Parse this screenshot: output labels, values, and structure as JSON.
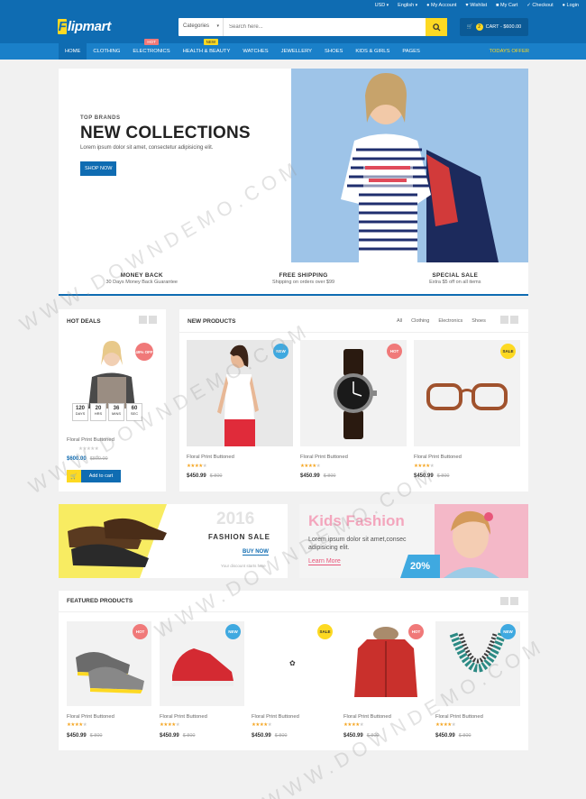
{
  "topbar": {
    "currency": "USD",
    "language": "English",
    "account": "My Account",
    "wishlist": "Wishlist",
    "cart": "My Cart",
    "checkout": "Checkout",
    "login": "Login"
  },
  "logo": "Flipmart",
  "search": {
    "category": "Categories",
    "placeholder": "Search here..."
  },
  "cart": {
    "count": "2",
    "label": "CART - $600.00"
  },
  "nav": {
    "items": [
      "HOME",
      "CLOTHING",
      "ELECTRONICS",
      "HEALTH & BEAUTY",
      "WATCHES",
      "JEWELLERY",
      "SHOES",
      "KIDS & GIRLS",
      "PAGES"
    ],
    "hot": "HOT",
    "new": "NEW",
    "today": "TODAYS OFFER"
  },
  "hero": {
    "top": "TOP BRANDS",
    "title": "NEW COLLECTIONS",
    "text": "Lorem ipsum dolor sit amet, consectetur adipisicing elit.",
    "btn": "SHOP NOW"
  },
  "features": [
    {
      "t": "MONEY BACK",
      "s": "30 Days Money Back Guarantee"
    },
    {
      "t": "FREE SHIPPING",
      "s": "Shipping on orders over $99"
    },
    {
      "t": "SPECIAL SALE",
      "s": "Extra $5 off on all items"
    }
  ],
  "hotdeals": {
    "title": "HOT DEALS",
    "badge": "49% OFF",
    "timer": [
      {
        "v": "120",
        "l": "DAYS"
      },
      {
        "v": "20",
        "l": "HRS"
      },
      {
        "v": "36",
        "l": "MINS"
      },
      {
        "v": "60",
        "l": "SEC"
      }
    ],
    "name": "Floral Print Buttoned",
    "price": "$600.00",
    "old": "$800.00",
    "btn": "Add to cart"
  },
  "newproducts": {
    "title": "NEW PRODUCTS",
    "tabs": [
      "All",
      "Clothing",
      "Electronics",
      "Shoes"
    ],
    "items": [
      {
        "badge": "NEW",
        "name": "Floral Print Buttoned",
        "price": "$450.99",
        "old": "$ 800"
      },
      {
        "badge": "HOT",
        "name": "Floral Print Buttoned",
        "price": "$450.99",
        "old": "$ 800"
      },
      {
        "badge": "SALE",
        "name": "Floral Print Buttoned",
        "price": "$450.99",
        "old": "$ 800"
      }
    ]
  },
  "banner1": {
    "year": "2016",
    "title": "FASHION SALE",
    "btn": "BUY NOW",
    "small": "Your discount starts here"
  },
  "banner2": {
    "title": "Kids Fashion",
    "text": "Lorem ipsum dolor sit amet,consec adipisicing elit.",
    "link": "Learn More",
    "pct": "20%"
  },
  "featured": {
    "title": "FEATURED PRODUCTS",
    "items": [
      {
        "badge": "HOT",
        "name": "Floral Print Buttoned",
        "price": "$450.99",
        "old": "$ 800"
      },
      {
        "badge": "NEW",
        "name": "Floral Print Buttoned",
        "price": "$450.99",
        "old": "$ 800"
      },
      {
        "badge": "SALE",
        "name": "Floral Print Buttoned",
        "price": "$450.99",
        "old": "$ 800"
      },
      {
        "badge": "HOT",
        "name": "Floral Print Buttoned",
        "price": "$450.99",
        "old": "$ 800"
      },
      {
        "badge": "NEW",
        "name": "Floral Print Buttoned",
        "price": "$450.99",
        "old": "$ 800"
      }
    ]
  },
  "watermark": "WWW.DOWNDEMO.COM",
  "colors": {
    "primary": "#0f6cb2",
    "accent": "#fdd922",
    "hot": "#f07979",
    "new": "#3fa9e0"
  }
}
